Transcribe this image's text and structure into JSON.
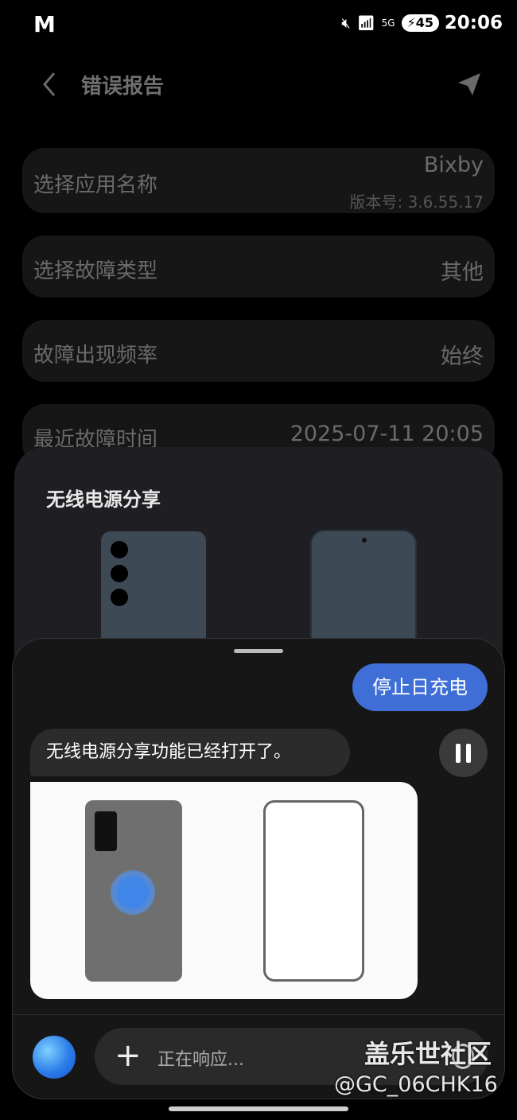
{
  "status_bar": {
    "logo": "M",
    "battery": "45",
    "time": "20:06",
    "network": "5G"
  },
  "header": {
    "title": "错误报告"
  },
  "form": {
    "app_label": "选择应用名称",
    "app_value": "Bixby",
    "app_version": "版本号: 3.6.55.17",
    "type_label": "选择故障类型",
    "type_value": "其他",
    "freq_label": "故障出现频率",
    "freq_value": "始终",
    "time_label": "最近故障时间",
    "time_value": "2025-07-11 20:05"
  },
  "wireless_sheet": {
    "title": "无线电源分享"
  },
  "assistant": {
    "user_message": "停止日充电",
    "bot_message": "无线电源分享功能已经打开了。",
    "input_placeholder": "正在响应..."
  },
  "watermark": {
    "line1": "盖乐世社区",
    "line2": "@GC_06CHK16"
  },
  "colors": {
    "accent": "#3f6fd6",
    "background": "#000000",
    "panel": "#161616"
  }
}
